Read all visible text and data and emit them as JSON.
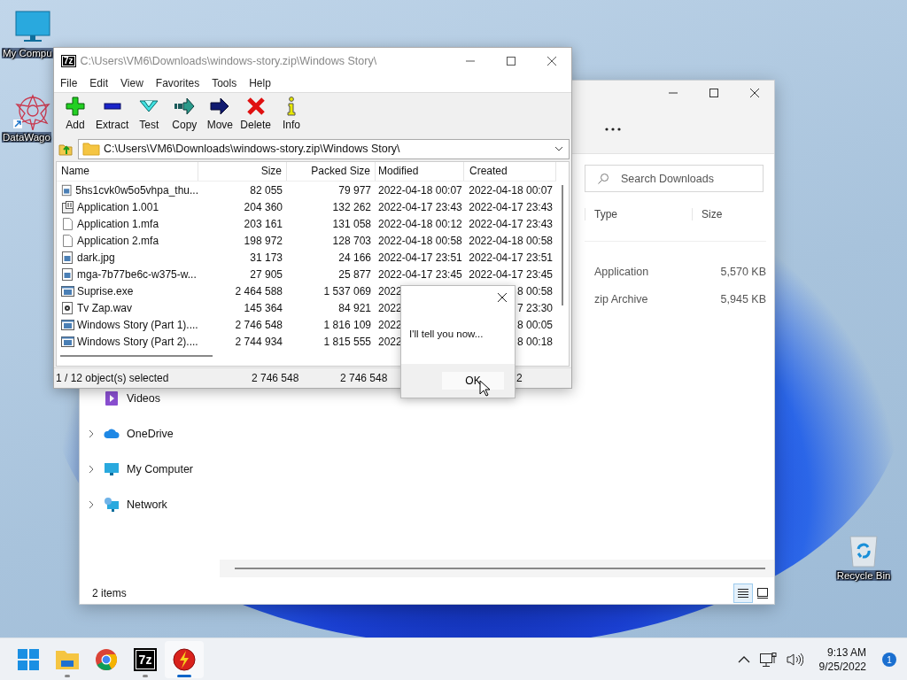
{
  "desktop_icons": [
    {
      "kind": "monitor",
      "label": "My Compu"
    },
    {
      "kind": "star",
      "label": "DataWago"
    },
    {
      "kind": "bin",
      "label": "Recycle Bin"
    }
  ],
  "explorer": {
    "search": {
      "placeholder": "Search Downloads"
    },
    "columns": [
      "Type",
      "Size"
    ],
    "rows": [
      {
        "type": "Application",
        "size": "5,570 KB"
      },
      {
        "type": "zip Archive",
        "size": "5,945 KB"
      }
    ],
    "sidebar": {
      "items": [
        {
          "kind": "videos",
          "label": "Videos",
          "expandable": false
        },
        {
          "kind": "cloud",
          "label": "OneDrive",
          "expandable": true
        },
        {
          "kind": "monitor",
          "label": "My Computer",
          "expandable": true
        },
        {
          "kind": "network",
          "label": "Network",
          "expandable": true
        }
      ]
    },
    "status": "2 items",
    "views": [
      {
        "kind": "details",
        "selected": true
      },
      {
        "kind": "tiles",
        "selected": false
      }
    ]
  },
  "archiver": {
    "logo_text": "7z",
    "title": "C:\\Users\\VM6\\Downloads\\windows-story.zip\\Windows Story\\",
    "menu": [
      "File",
      "Edit",
      "View",
      "Favorites",
      "Tools",
      "Help"
    ],
    "toolbar": [
      {
        "kind": "add",
        "label": "Add"
      },
      {
        "kind": "extract",
        "label": "Extract"
      },
      {
        "kind": "test",
        "label": "Test"
      },
      {
        "kind": "copy",
        "label": "Copy"
      },
      {
        "kind": "move",
        "label": "Move"
      },
      {
        "kind": "delete",
        "label": "Delete"
      },
      {
        "kind": "info",
        "label": "Info"
      }
    ],
    "address": "C:\\Users\\VM6\\Downloads\\windows-story.zip\\Windows Story\\",
    "columns": [
      "Name",
      "Size",
      "Packed Size",
      "Modified",
      "Created"
    ],
    "rows": [
      {
        "kind": "image",
        "name": "5hs1cvk0w5o5vhpa_thu...",
        "size": "82 055",
        "packed": "79 977",
        "modified": "2022-04-18 00:07",
        "created": "2022-04-18 00:07"
      },
      {
        "kind": "split",
        "name": "Application 1.001",
        "size": "204 360",
        "packed": "132 262",
        "modified": "2022-04-17 23:43",
        "created": "2022-04-17 23:43"
      },
      {
        "kind": "file",
        "name": "Application 1.mfa",
        "size": "203 161",
        "packed": "131 058",
        "modified": "2022-04-18 00:12",
        "created": "2022-04-17 23:43"
      },
      {
        "kind": "file",
        "name": "Application 2.mfa",
        "size": "198 972",
        "packed": "128 703",
        "modified": "2022-04-18 00:58",
        "created": "2022-04-18 00:58"
      },
      {
        "kind": "image",
        "name": "dark.jpg",
        "size": "31 173",
        "packed": "24 166",
        "modified": "2022-04-17 23:51",
        "created": "2022-04-17 23:51"
      },
      {
        "kind": "image",
        "name": "mga-7b77be6c-w375-w...",
        "size": "27 905",
        "packed": "25 877",
        "modified": "2022-04-17 23:45",
        "created": "2022-04-17 23:45"
      },
      {
        "kind": "app",
        "name": "Suprise.exe",
        "size": "2 464 588",
        "packed": "1 537 069",
        "modified": "2022",
        "created": "8 00:58"
      },
      {
        "kind": "audio",
        "name": "Tv Zap.wav",
        "size": "145 364",
        "packed": "84 921",
        "modified": "2022",
        "created": "7 23:30"
      },
      {
        "kind": "app",
        "name": "Windows Story (Part 1)....",
        "size": "2 746 548",
        "packed": "1 816 109",
        "modified": "2022",
        "created": "8 00:05"
      },
      {
        "kind": "app",
        "name": "Windows Story (Part 2)....",
        "size": "2 744 934",
        "packed": "1 815 555",
        "modified": "2022",
        "created": "8 00:18"
      }
    ],
    "status": [
      "1 / 12 object(s) selected",
      "2 746 548",
      "2 746 548",
      "2"
    ]
  },
  "dialog": {
    "message": "I'll tell you now...",
    "button": "OK"
  },
  "taskbar": {
    "apps": [
      {
        "kind": "start",
        "running": false,
        "active": false
      },
      {
        "kind": "folder",
        "running": true,
        "active": false
      },
      {
        "kind": "browser",
        "running": false,
        "active": false
      },
      {
        "kind": "sevenzip",
        "logo_text": "7z",
        "running": true,
        "active": false
      },
      {
        "kind": "bolt",
        "running": true,
        "active": true
      }
    ],
    "time": "9:13 AM",
    "date": "9/25/2022",
    "notifications": "1"
  }
}
